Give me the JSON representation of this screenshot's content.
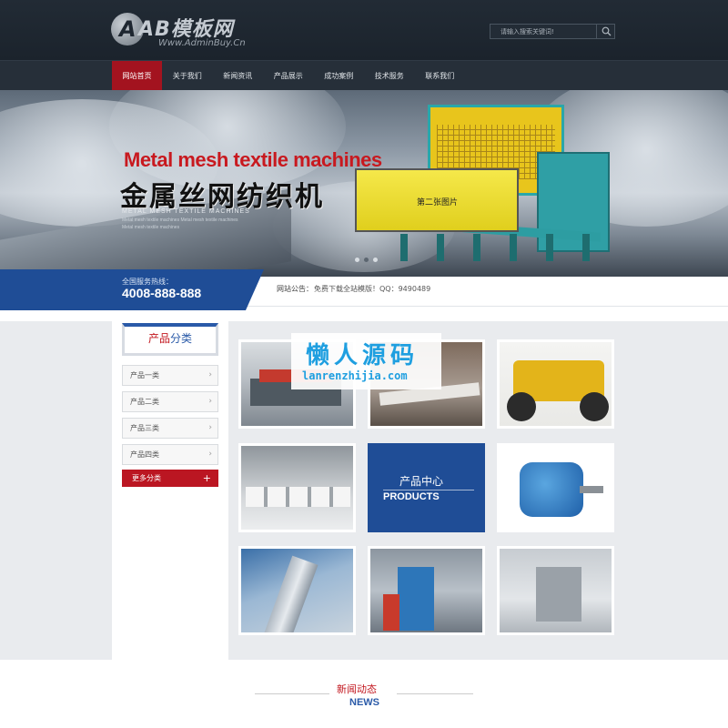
{
  "header": {
    "logo_mark": "A",
    "logo_title": "AB模板网",
    "logo_sub": "Www.AdminBuy.Cn",
    "search_placeholder": "请输入搜索关键词!"
  },
  "nav": {
    "items": [
      "网站首页",
      "关于我们",
      "新闻资讯",
      "产品展示",
      "成功案例",
      "技术服务",
      "联系我们"
    ],
    "active_index": 0
  },
  "banner": {
    "title_en": "Metal mesh textile machines",
    "title_cn": "金属丝网纺织机",
    "subtitle": "METAL MESH TEXTILE MACHINES",
    "small_lines": [
      "Metal mesh textile machines Metal mesh textile machines",
      "Metal mesh textile machines"
    ],
    "image_caption": "第二张图片",
    "slide_count": 3,
    "active_slide": 2
  },
  "hotline": {
    "label": "全国服务热线：",
    "phone": "4008-888-888",
    "notice_label": "网站公告：",
    "notice_text": "免费下载全站模版！QQ：9490489"
  },
  "sidebar": {
    "heading_a": "产品",
    "heading_b": "分类",
    "categories": [
      "产品一类",
      "产品二类",
      "产品三类",
      "产品四类"
    ],
    "more": "更多分类"
  },
  "products": {
    "center_cn": "产品中心",
    "center_en": "PRODUCTS",
    "tiles": [
      "printing-press",
      "industrial-pipeline",
      "yellow-loader",
      "factory-floor",
      "electric-motor",
      "pipes",
      "blue-machinery",
      "gray-equipment"
    ]
  },
  "watermark": {
    "cn": "懒人源码",
    "en": "lanrenzhijia.com"
  },
  "news": {
    "cn": "新闻动态",
    "en": "NEWS"
  },
  "colors": {
    "brand_red": "#bb1622",
    "brand_blue": "#1f4d96",
    "header_dark": "#1e2630"
  }
}
